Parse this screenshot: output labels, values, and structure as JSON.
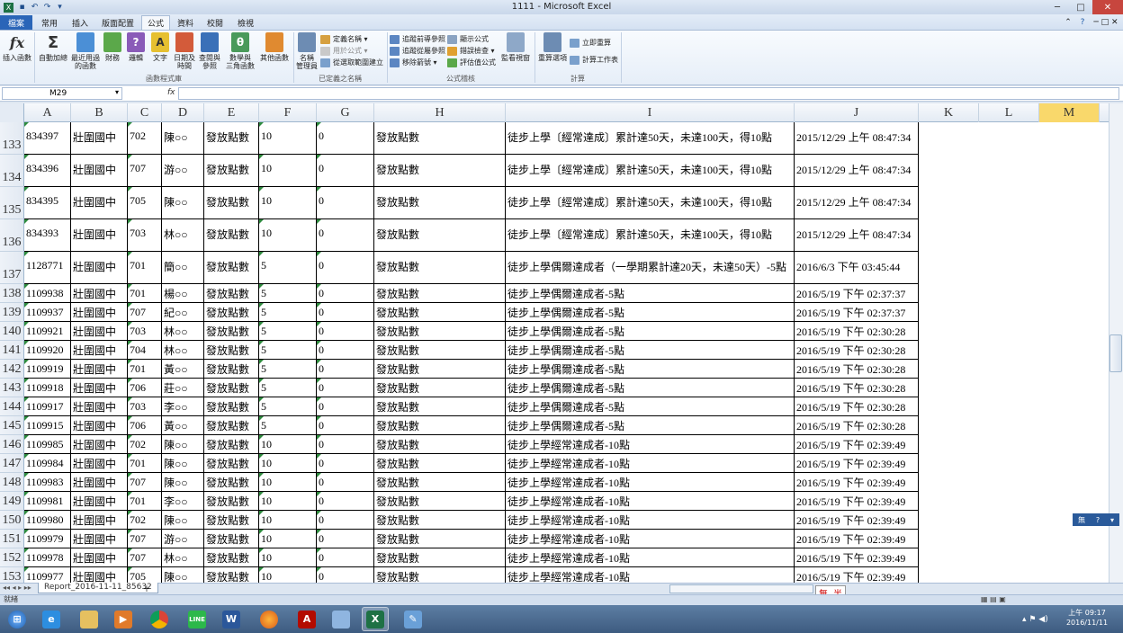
{
  "window": {
    "title": "1111 - Microsoft Excel"
  },
  "tabs": [
    {
      "label": "檔案"
    },
    {
      "label": "常用"
    },
    {
      "label": "插入"
    },
    {
      "label": "版面配置"
    },
    {
      "label": "公式"
    },
    {
      "label": "資料"
    },
    {
      "label": "校閱"
    },
    {
      "label": "檢視"
    }
  ],
  "ribbon": {
    "insert_function": "插入函數",
    "autosum": "自動加總",
    "recent": [
      "最近用過",
      "的函數"
    ],
    "financial": "財務",
    "logical": "邏輯",
    "text": "文字",
    "datetime": [
      "日期及",
      "時間"
    ],
    "lookup": [
      "查閱與",
      "參照"
    ],
    "math": [
      "數學與",
      "三角函數"
    ],
    "other": "其他函數",
    "group_library": "函數程式庫",
    "name_manager": [
      "名稱",
      "管理員"
    ],
    "define_name": "定義名稱",
    "use_in_formula": "用於公式",
    "create_from_sel": "從選取範圍建立",
    "group_names": "已定義之名稱",
    "trace_prec": "追蹤前導參照",
    "trace_dep": "追蹤從屬參照",
    "remove_arrows": "移除箭號",
    "show_formulas": "顯示公式",
    "error_check": "錯誤檢查",
    "evaluate": "評估值公式",
    "group_audit": "公式稽核",
    "watch": "監看視窗",
    "calc_options": "重算選項",
    "calc_now": "立即重算",
    "calc_sheet": "計算工作表",
    "group_calc": "計算"
  },
  "formula_bar": {
    "name_box": "M29",
    "fx": "fx",
    "formula": ""
  },
  "columns": [
    "A",
    "B",
    "C",
    "D",
    "E",
    "F",
    "G",
    "H",
    "I",
    "J",
    "K",
    "L",
    "M"
  ],
  "rows": [
    {
      "n": "133",
      "a": "834397",
      "b": "壯圍國中",
      "c": "702",
      "d": "陳○○",
      "e": "發放點數",
      "f": "10",
      "g": "0",
      "h": "發放點數",
      "i": "徒步上學〔經常達成〕累計達50天，未達100天，得10點",
      "j": "2015/12/29 上午 08:47:34"
    },
    {
      "n": "134",
      "a": "834396",
      "b": "壯圍國中",
      "c": "707",
      "d": "游○○",
      "e": "發放點數",
      "f": "10",
      "g": "0",
      "h": "發放點數",
      "i": "徒步上學〔經常達成〕累計達50天，未達100天，得10點",
      "j": "2015/12/29 上午 08:47:34"
    },
    {
      "n": "135",
      "a": "834395",
      "b": "壯圍國中",
      "c": "705",
      "d": "陳○○",
      "e": "發放點數",
      "f": "10",
      "g": "0",
      "h": "發放點數",
      "i": "徒步上學〔經常達成〕累計達50天，未達100天，得10點",
      "j": "2015/12/29 上午 08:47:34"
    },
    {
      "n": "136",
      "a": "834393",
      "b": "壯圍國中",
      "c": "703",
      "d": "林○○",
      "e": "發放點數",
      "f": "10",
      "g": "0",
      "h": "發放點數",
      "i": "徒步上學〔經常達成〕累計達50天，未達100天，得10點",
      "j": "2015/12/29 上午 08:47:34"
    },
    {
      "n": "137",
      "a": "1128771",
      "b": "壯圍國中",
      "c": "701",
      "d": "簡○○",
      "e": "發放點數",
      "f": "5",
      "g": "0",
      "h": "發放點數",
      "i": "徒步上學偶爾達成者（一學期累計達20天，未達50天）-5點",
      "j": "2016/6/3 下午 03:45:44"
    },
    {
      "n": "138",
      "a": "1109938",
      "b": "壯圍國中",
      "c": "701",
      "d": "楊○○",
      "e": "發放點數",
      "f": "5",
      "g": "0",
      "h": "發放點數",
      "i": "徒步上學偶爾達成者-5點",
      "j": "2016/5/19 下午 02:37:37"
    },
    {
      "n": "139",
      "a": "1109937",
      "b": "壯圍國中",
      "c": "707",
      "d": "紀○○",
      "e": "發放點數",
      "f": "5",
      "g": "0",
      "h": "發放點數",
      "i": "徒步上學偶爾達成者-5點",
      "j": "2016/5/19 下午 02:37:37"
    },
    {
      "n": "140",
      "a": "1109921",
      "b": "壯圍國中",
      "c": "703",
      "d": "林○○",
      "e": "發放點數",
      "f": "5",
      "g": "0",
      "h": "發放點數",
      "i": "徒步上學偶爾達成者-5點",
      "j": "2016/5/19 下午 02:30:28"
    },
    {
      "n": "141",
      "a": "1109920",
      "b": "壯圍國中",
      "c": "704",
      "d": "林○○",
      "e": "發放點數",
      "f": "5",
      "g": "0",
      "h": "發放點數",
      "i": "徒步上學偶爾達成者-5點",
      "j": "2016/5/19 下午 02:30:28"
    },
    {
      "n": "142",
      "a": "1109919",
      "b": "壯圍國中",
      "c": "701",
      "d": "黃○○",
      "e": "發放點數",
      "f": "5",
      "g": "0",
      "h": "發放點數",
      "i": "徒步上學偶爾達成者-5點",
      "j": "2016/5/19 下午 02:30:28"
    },
    {
      "n": "143",
      "a": "1109918",
      "b": "壯圍國中",
      "c": "706",
      "d": "莊○○",
      "e": "發放點數",
      "f": "5",
      "g": "0",
      "h": "發放點數",
      "i": "徒步上學偶爾達成者-5點",
      "j": "2016/5/19 下午 02:30:28"
    },
    {
      "n": "144",
      "a": "1109917",
      "b": "壯圍國中",
      "c": "703",
      "d": "李○○",
      "e": "發放點數",
      "f": "5",
      "g": "0",
      "h": "發放點數",
      "i": "徒步上學偶爾達成者-5點",
      "j": "2016/5/19 下午 02:30:28"
    },
    {
      "n": "145",
      "a": "1109915",
      "b": "壯圍國中",
      "c": "706",
      "d": "黃○○",
      "e": "發放點數",
      "f": "5",
      "g": "0",
      "h": "發放點數",
      "i": "徒步上學偶爾達成者-5點",
      "j": "2016/5/19 下午 02:30:28"
    },
    {
      "n": "146",
      "a": "1109985",
      "b": "壯圍國中",
      "c": "702",
      "d": "陳○○",
      "e": "發放點數",
      "f": "10",
      "g": "0",
      "h": "發放點數",
      "i": "徒步上學經常達成者-10點",
      "j": "2016/5/19 下午 02:39:49"
    },
    {
      "n": "147",
      "a": "1109984",
      "b": "壯圍國中",
      "c": "701",
      "d": "陳○○",
      "e": "發放點數",
      "f": "10",
      "g": "0",
      "h": "發放點數",
      "i": "徒步上學經常達成者-10點",
      "j": "2016/5/19 下午 02:39:49"
    },
    {
      "n": "148",
      "a": "1109983",
      "b": "壯圍國中",
      "c": "707",
      "d": "陳○○",
      "e": "發放點數",
      "f": "10",
      "g": "0",
      "h": "發放點數",
      "i": "徒步上學經常達成者-10點",
      "j": "2016/5/19 下午 02:39:49"
    },
    {
      "n": "149",
      "a": "1109981",
      "b": "壯圍國中",
      "c": "701",
      "d": "李○○",
      "e": "發放點數",
      "f": "10",
      "g": "0",
      "h": "發放點數",
      "i": "徒步上學經常達成者-10點",
      "j": "2016/5/19 下午 02:39:49"
    },
    {
      "n": "150",
      "a": "1109980",
      "b": "壯圍國中",
      "c": "702",
      "d": "陳○○",
      "e": "發放點數",
      "f": "10",
      "g": "0",
      "h": "發放點數",
      "i": "徒步上學經常達成者-10點",
      "j": "2016/5/19 下午 02:39:49"
    },
    {
      "n": "151",
      "a": "1109979",
      "b": "壯圍國中",
      "c": "707",
      "d": "游○○",
      "e": "發放點數",
      "f": "10",
      "g": "0",
      "h": "發放點數",
      "i": "徒步上學經常達成者-10點",
      "j": "2016/5/19 下午 02:39:49"
    },
    {
      "n": "152",
      "a": "1109978",
      "b": "壯圍國中",
      "c": "707",
      "d": "林○○",
      "e": "發放點數",
      "f": "10",
      "g": "0",
      "h": "發放點數",
      "i": "徒步上學經常達成者-10點",
      "j": "2016/5/19 下午 02:39:49"
    },
    {
      "n": "153",
      "a": "1109977",
      "b": "壯圍國中",
      "c": "705",
      "d": "陳○○",
      "e": "發放點數",
      "f": "10",
      "g": "0",
      "h": "發放點數",
      "i": "徒步上學經常達成者-10點",
      "j": "2016/5/19 下午 02:39:49"
    }
  ],
  "sheet_tab": "Report_2016-11-11_85632",
  "status": "就緒",
  "ime": {
    "a": "無",
    "b": "半"
  },
  "ime_float": "無",
  "clock": {
    "time": "上午 09:17",
    "date": "2016/11/11"
  },
  "colors": {
    "accent": "#2a65b8",
    "selected_header": "#f9d86b",
    "comment_triangle": "#2e8b3e"
  }
}
